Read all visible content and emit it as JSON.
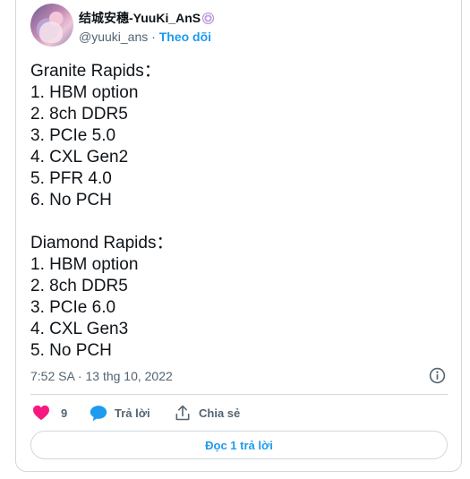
{
  "author": {
    "display_name": "结城安穗-YuuKi_AnS",
    "handle": "@yuuki_ans",
    "separator": "·",
    "follow_label": "Theo dõi"
  },
  "tweet": {
    "lines": [
      "Granite Rapids：",
      "1. HBM option",
      "2. 8ch DDR5",
      "3. PCIe 5.0",
      "4. CXL Gen2",
      "5. PFR 4.0",
      "6. No PCH",
      "",
      "Diamond Rapids：",
      "1. HBM option",
      "2. 8ch DDR5",
      "3. PCIe 6.0",
      "4. CXL Gen3",
      "5. No PCH"
    ],
    "timestamp": "7:52 SA · 13 thg 10, 2022"
  },
  "actions": {
    "like_count": "9",
    "reply_label": "Trả lời",
    "share_label": "Chia sẻ"
  },
  "read_replies_label": "Đọc 1 trả lời",
  "colors": {
    "accent": "#1d9bf0",
    "like": "#f91880",
    "muted": "#536471",
    "border": "#cfd9de"
  }
}
